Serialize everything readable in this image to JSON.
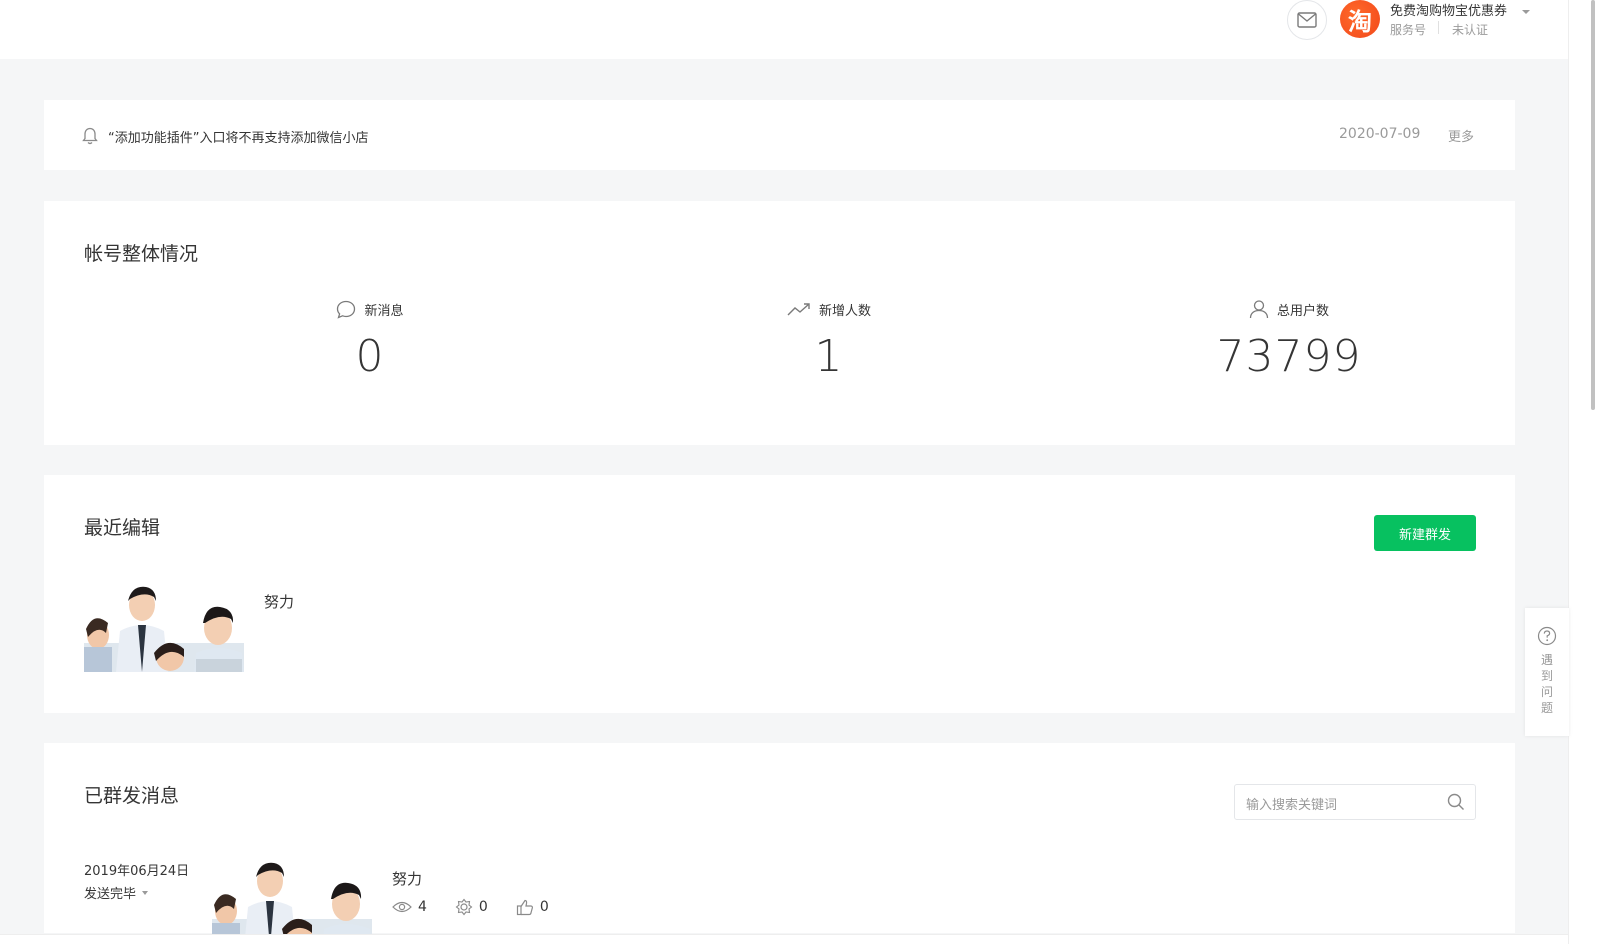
{
  "header": {
    "account_name": "免费淘购物宝优惠券",
    "account_type": "服务号",
    "account_verify": "未认证",
    "logo_char": "淘",
    "brand_color": "#f2481b"
  },
  "notice": {
    "text": "“添加功能插件”入口将不再支持添加微信小店",
    "date": "2020-07-09",
    "more_label": "更多"
  },
  "overview": {
    "title": "帐号整体情况",
    "stats": [
      {
        "label": "新消息",
        "value": "0",
        "icon": "chat-bubble-icon"
      },
      {
        "label": "新增人数",
        "value": "1",
        "icon": "trend-up-icon"
      },
      {
        "label": "总用户数",
        "value": "73799",
        "icon": "user-icon"
      }
    ]
  },
  "recent": {
    "title": "最近编辑",
    "new_button_label": "新建群发",
    "draft_title": "努力",
    "accent_color": "#07c160"
  },
  "sent": {
    "title": "已群发消息",
    "search_placeholder": "输入搜索关键词",
    "items": [
      {
        "date": "2019年06月24日",
        "status": "发送完毕",
        "title": "努力",
        "reads": "4",
        "shares": "0",
        "likes": "0"
      }
    ]
  },
  "help": {
    "label": "遇到问题"
  }
}
